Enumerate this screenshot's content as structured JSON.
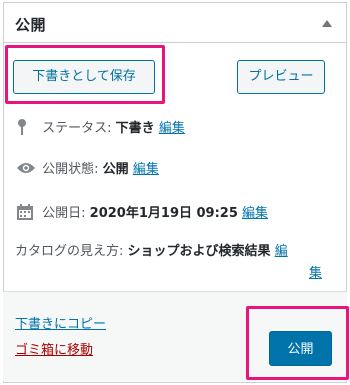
{
  "panel": {
    "title": "公開",
    "toggle_icon": "triangle-up-icon"
  },
  "actions": {
    "save_draft_label": "下書きとして保存",
    "preview_label": "プレビュー"
  },
  "meta": {
    "status": {
      "icon": "pin-icon",
      "label": "ステータス:",
      "value": "下書き",
      "edit": "編集"
    },
    "visibility": {
      "icon": "eye-icon",
      "label": "公開状態:",
      "value": "公開",
      "edit": "編集"
    },
    "date": {
      "icon": "calendar-icon",
      "label": "公開日:",
      "value": "2020年1月19日 09:25",
      "edit": "編集"
    },
    "catalog": {
      "label": "カタログの見え方:",
      "value": "ショップおよび検索結果",
      "edit_part1": "編",
      "edit_part2": "集"
    }
  },
  "footer": {
    "copy_draft": "下書きにコピー",
    "trash": "ゴミ箱に移動",
    "publish_label": "公開"
  },
  "colors": {
    "accent": "#0073aa",
    "highlight": "#e8157f",
    "trash": "#aa0000"
  }
}
